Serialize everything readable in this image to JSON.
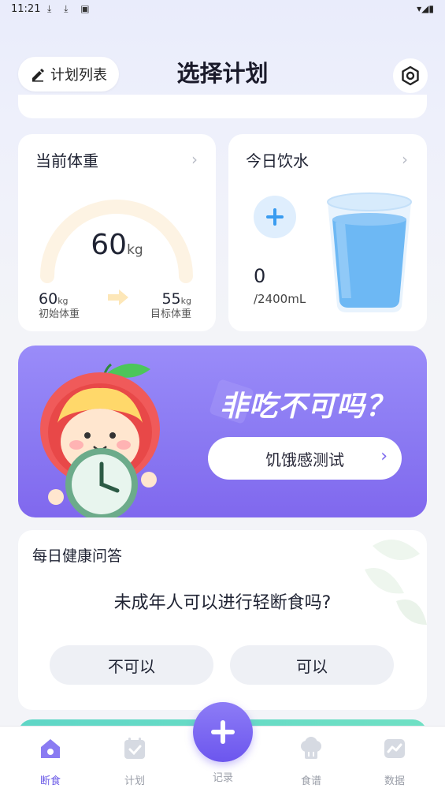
{
  "status_bar": {
    "time": "11:21",
    "icons": "⤓ ⤓ ▣",
    "right_icons": "▾◢▮"
  },
  "header": {
    "plan_list_label": "计划列表",
    "title": "选择计划"
  },
  "weight_card": {
    "title": "当前体重",
    "current_value": "60",
    "current_unit": "kg",
    "initial_value": "60",
    "initial_unit": "kg",
    "initial_label": "初始体重",
    "target_value": "55",
    "target_unit": "kg",
    "target_label": "目标体重"
  },
  "water_card": {
    "title": "今日饮水",
    "amount": "0",
    "goal": "/2400mL"
  },
  "banner": {
    "title": "非吃不可吗？",
    "button_label": "饥饿感测试"
  },
  "qa_card": {
    "title": "每日健康问答",
    "question": "未成年人可以进行轻断食吗?",
    "option_no": "不可以",
    "option_yes": "可以"
  },
  "tabbar": {
    "tabs": [
      {
        "label": "断食",
        "active": true
      },
      {
        "label": "计划",
        "active": false
      },
      {
        "label": "记录",
        "active": false
      },
      {
        "label": "食谱",
        "active": false
      },
      {
        "label": "数据",
        "active": false
      }
    ]
  },
  "colors": {
    "accent": "#6c5ce7",
    "banner": "#8a79f2",
    "water": "#4aa8f0"
  }
}
